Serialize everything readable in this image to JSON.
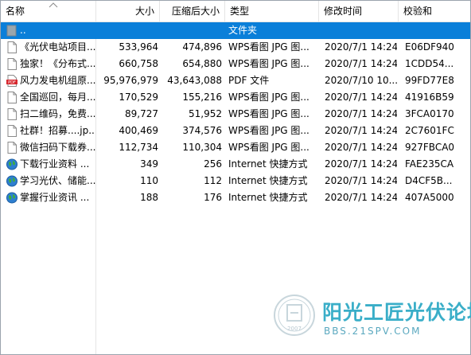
{
  "columns": {
    "name": "名称",
    "size": "大小",
    "compressed": "压缩后大小",
    "type": "类型",
    "modified": "修改时间",
    "crc": "校验和"
  },
  "rows": [
    {
      "icon": "folder-up-icon",
      "name": "..",
      "size": "",
      "compressed": "",
      "type": "文件夹",
      "modified": "",
      "crc": "",
      "selected": true
    },
    {
      "icon": "file-icon",
      "name": "《光伏电站项目...",
      "size": "533,964",
      "compressed": "474,896",
      "type": "WPS看图 JPG 图...",
      "modified": "2020/7/1 14:24",
      "crc": "E06DF940"
    },
    {
      "icon": "file-icon",
      "name": "独家！《分布式...",
      "size": "660,758",
      "compressed": "654,880",
      "type": "WPS看图 JPG 图...",
      "modified": "2020/7/1 14:24",
      "crc": "1CDD54..."
    },
    {
      "icon": "pdf-icon",
      "name": "风力发电机组原...",
      "size": "95,976,979",
      "compressed": "43,643,088",
      "type": "PDF 文件",
      "modified": "2020/7/10 10...",
      "crc": "99FD77E8"
    },
    {
      "icon": "file-icon",
      "name": "全国巡回，每月...",
      "size": "170,529",
      "compressed": "155,216",
      "type": "WPS看图 JPG 图...",
      "modified": "2020/7/1 14:24",
      "crc": "41916B59"
    },
    {
      "icon": "file-icon",
      "name": "扫二维码，免费...",
      "size": "89,727",
      "compressed": "51,952",
      "type": "WPS看图 JPG 图...",
      "modified": "2020/7/1 14:24",
      "crc": "3FCA0170"
    },
    {
      "icon": "file-icon",
      "name": "社群！招募....jp...",
      "size": "400,469",
      "compressed": "374,576",
      "type": "WPS看图 JPG 图...",
      "modified": "2020/7/1 14:24",
      "crc": "2C7601FC"
    },
    {
      "icon": "file-icon",
      "name": "微信扫码下载券...",
      "size": "112,734",
      "compressed": "110,304",
      "type": "WPS看图 JPG 图...",
      "modified": "2020/7/1 14:24",
      "crc": "927FBCA0"
    },
    {
      "icon": "globe-icon",
      "name": "下载行业资料 ...",
      "size": "349",
      "compressed": "256",
      "type": "Internet 快捷方式",
      "modified": "2020/7/1 14:24",
      "crc": "FAE235CA"
    },
    {
      "icon": "globe-icon",
      "name": "学习光伏、储能...",
      "size": "110",
      "compressed": "112",
      "type": "Internet 快捷方式",
      "modified": "2020/7/1 14:24",
      "crc": "D4CF5B..."
    },
    {
      "icon": "globe-icon",
      "name": "掌握行业资讯 ...",
      "size": "188",
      "compressed": "176",
      "type": "Internet 快捷方式",
      "modified": "2020/7/1 14:24",
      "crc": "407A5000"
    }
  ],
  "watermark": {
    "title": "阳光工匠光伏论坛",
    "url": "BBS.21SPV.COM",
    "year": "2007"
  },
  "colors": {
    "selection": "#0a7fd9",
    "watermark": "#3aaec8"
  }
}
